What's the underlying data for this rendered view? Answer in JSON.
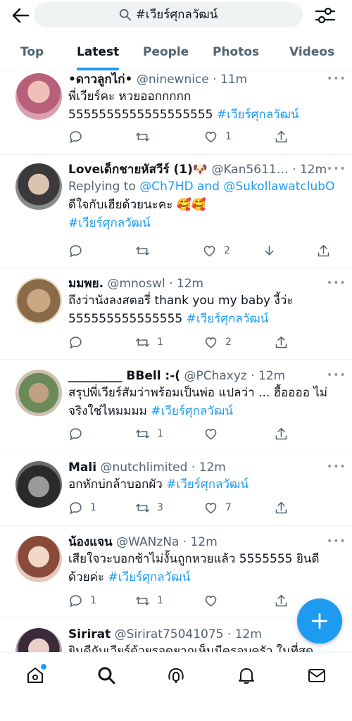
{
  "colors": {
    "accent": "#1d9bf0",
    "text": "#0f1419",
    "muted": "#536471",
    "fab": "#1d9bf0"
  },
  "search": {
    "query": "#เวียร์ศุกลวัฒน์"
  },
  "tabs": [
    {
      "label": "Top",
      "active": false
    },
    {
      "label": "Latest",
      "active": true
    },
    {
      "label": "People",
      "active": false
    },
    {
      "label": "Photos",
      "active": false
    },
    {
      "label": "Videos",
      "active": false
    }
  ],
  "tweets": [
    {
      "name": "•ดาวลูกไก่•",
      "handle": "@ninewnice",
      "time": "11m",
      "line1": "พี่เวียร์คะ หวยออกกกกก",
      "line2": "5555555555555555555",
      "tag": "#เวียร์ศุกลวัฒน์",
      "replies": "",
      "retweets": "",
      "likes": "1"
    },
    {
      "name": "Loveเด็กชายหัสวีร์ (1)🐶",
      "handle": "@Kan5611…",
      "time": "12m",
      "reply_prefix": "Replying to",
      "reply_mentions": "@Ch7HD and @SukollawatclubO",
      "line1": "ดีใจกับเฮียด้วยนะคะ 🥰🥰",
      "tag": "#เวียร์ศุกลวัฒน์",
      "replies": "",
      "retweets": "",
      "likes": "2"
    },
    {
      "name": "มมพย.",
      "handle": "@mnoswl",
      "time": "12m",
      "line1": "ถึงว่านังลงสตอรี่ thank you my baby งี้ว่ะ",
      "line2": "555555555555555",
      "tag": "#เวียร์ศุกลวัฒน์",
      "replies": "",
      "retweets": "1",
      "likes": "2"
    },
    {
      "name": "_________ BBell :-(",
      "handle": "@PChaxyz",
      "time": "12m",
      "line1": "สรุปพี่เวียร์สัมว่าพร้อมเป็นพ่อ แปลว่า ... ฮื้ออออ ไม่",
      "line2": "จริงใช่ไหมมมม",
      "tag": "#เวียร์ศุกลวัฒน์",
      "replies": "",
      "retweets": "1",
      "likes": ""
    },
    {
      "name": "Mali",
      "handle": "@nutchlimited",
      "time": "12m",
      "line1": "อกหักบ่กล้าบอกผัว",
      "tag": "#เวียร์ศุกลวัฒน์",
      "replies": "1",
      "retweets": "3",
      "likes": "7"
    },
    {
      "name": "น้องแจน",
      "handle": "@WANzNa",
      "time": "12m",
      "line1": "เสียใจวะบอกช้าไม่งั้นถูกหวยแล้ว 5555555 ยินดี",
      "line2": "ด้วยค่ะ",
      "tag": "#เวียร์ศุกลวัฒน์",
      "replies": "1",
      "retweets": "1",
      "likes": ""
    },
    {
      "name": "Sirirat",
      "handle": "@Sirirat75041075",
      "time": "12m",
      "line1": "ยินดีกับเวียร์ด้วยรอดูยากเห็นมีครอบครัว ในที่สุด"
    }
  ],
  "icons": {
    "back": "arrow-left-icon",
    "search": "search-icon",
    "filter": "sliders-icon",
    "reply": "reply-icon",
    "retweet": "retweet-icon",
    "like": "heart-icon",
    "share": "share-icon",
    "fab": "plus-icon",
    "home": "home-icon",
    "explore": "search-icon",
    "spaces": "microphone-icon",
    "notifications": "bell-icon",
    "messages": "mail-icon"
  }
}
